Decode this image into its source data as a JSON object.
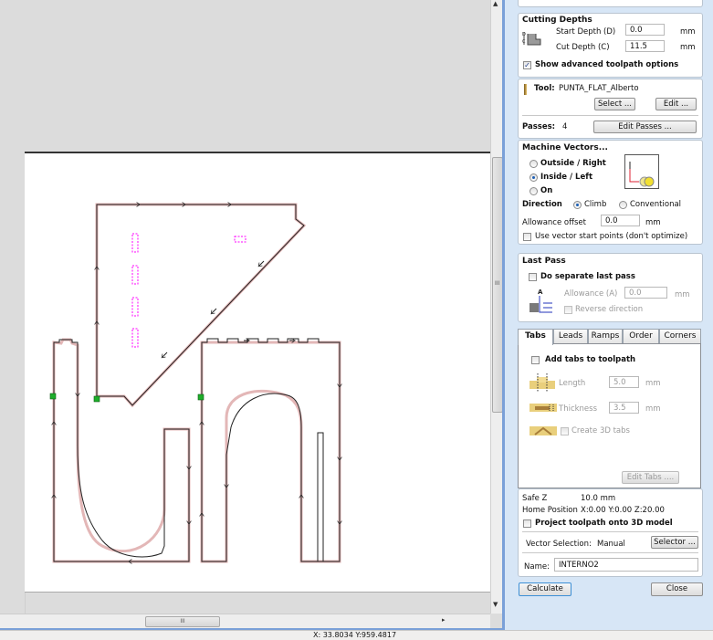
{
  "canvas": {
    "status_coords": "X: 33.8034 Y:959.4817",
    "hscroll_grip": "III",
    "vscroll_grip": "III",
    "colors": {
      "vector_line": "#222222",
      "toolpath_shadow": "#e3b7b7",
      "tab_marker": "#ff00ff",
      "start_point": "#1fae2b"
    }
  },
  "panel": {
    "cutting_depths": {
      "title": "Cutting Depths",
      "start_depth_label": "Start Depth (D)",
      "start_depth_value": "0.0",
      "cut_depth_label": "Cut Depth (C)",
      "cut_depth_value": "11.5",
      "unit": "mm",
      "show_advanced_label": "Show advanced toolpath options",
      "show_advanced_checked": true,
      "icon": "depth-diagram-icon"
    },
    "tool": {
      "label": "Tool:",
      "name": "PUNTA_FLAT_Alberto",
      "select_label": "Select ...",
      "edit_label": "Edit ...",
      "passes_label": "Passes:",
      "passes_value": "4",
      "edit_passes_label": "Edit Passes ..."
    },
    "machine_vectors": {
      "title": "Machine Vectors...",
      "options": [
        "Outside / Right",
        "Inside / Left",
        "On"
      ],
      "selected": "Inside / Left",
      "direction_label": "Direction",
      "direction_options": [
        "Climb",
        "Conventional"
      ],
      "direction_selected": "Climb",
      "allowance_label": "Allowance offset",
      "allowance_value": "0.0",
      "unit": "mm",
      "use_start_points_label": "Use vector start points (don't optimize)",
      "use_start_points_checked": false
    },
    "last_pass": {
      "title": "Last Pass",
      "separate_label": "Do separate last pass",
      "separate_checked": false,
      "allowance_label": "Allowance (A)",
      "allowance_value": "0.0",
      "unit": "mm",
      "reverse_label": "Reverse direction",
      "reverse_checked": false
    },
    "tabs": {
      "items": [
        "Tabs",
        "Leads",
        "Ramps",
        "Order",
        "Corners"
      ],
      "active": "Tabs",
      "add_tabs_label": "Add tabs to toolpath",
      "add_tabs_checked": false,
      "length_label": "Length",
      "length_value": "5.0",
      "thickness_label": "Thickness",
      "thickness_value": "3.5",
      "unit": "mm",
      "create_3d_label": "Create 3D tabs",
      "create_3d_checked": false,
      "edit_tabs_label": "Edit Tabs ...."
    },
    "misc": {
      "safe_z_label": "Safe Z",
      "safe_z_value": "10.0 mm",
      "home_label": "Home Position",
      "home_value": "X:0.00 Y:0.00 Z:20.00",
      "project_label": "Project toolpath onto 3D model",
      "project_checked": false,
      "vector_selection_label": "Vector Selection:",
      "vector_selection_value": "Manual",
      "selector_label": "Selector ...",
      "name_label": "Name:",
      "name_value": "INTERNO2"
    },
    "calculate_label": "Calculate",
    "close_label": "Close"
  }
}
